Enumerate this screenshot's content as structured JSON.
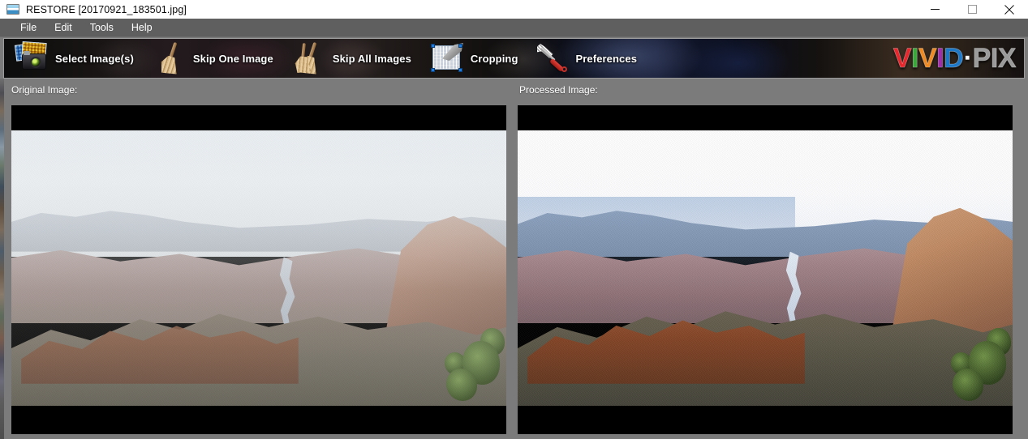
{
  "window": {
    "app_name": "RESTORE",
    "title": "RESTORE  [20170921_183501.jpg]",
    "file_name": "20170921_183501.jpg",
    "icon": "photo-window-icon",
    "controls": {
      "minimize": "minimize-icon",
      "maximize": "maximize-icon",
      "close": "close-icon"
    }
  },
  "menubar": {
    "items": [
      {
        "label": "File"
      },
      {
        "label": "Edit"
      },
      {
        "label": "Tools"
      },
      {
        "label": "Help"
      }
    ]
  },
  "toolbar": {
    "buttons": [
      {
        "label": "Select Image(s)",
        "icon": "camera-photos-icon"
      },
      {
        "label": "Skip One Image",
        "icon": "broom-icon"
      },
      {
        "label": "Skip All Images",
        "icon": "double-broom-icon"
      },
      {
        "label": "Cropping",
        "icon": "crop-grid-icon"
      },
      {
        "label": "Preferences",
        "icon": "wrench-screwdriver-icon"
      }
    ],
    "logo": {
      "letters": [
        {
          "char": "V",
          "color": "#e8262c"
        },
        {
          "char": "I",
          "color": "#3aa83a"
        },
        {
          "char": "V",
          "color": "#ef8a22"
        },
        {
          "char": "I",
          "color": "#a22bb0"
        },
        {
          "char": "D",
          "color": "#1d78c8"
        },
        {
          "char": "·",
          "color": "#ffffff"
        },
        {
          "char": "P",
          "color": "#9a9a9a"
        },
        {
          "char": "I",
          "color": "#9a9a9a"
        },
        {
          "char": "X",
          "color": "#9a9a9a"
        }
      ],
      "text": "VIVID-PIX"
    }
  },
  "panels": {
    "original": {
      "label": "Original Image:",
      "image_description": "Hazy wide view of the Grand Canyon with the Colorado River, letterboxed with black bars"
    },
    "processed": {
      "label": "Processed Image:",
      "image_description": "Same Grand Canyon view after restoration: brighter sky, stronger contrast and color saturation"
    }
  },
  "colors": {
    "window_chrome": "#7b7b7b",
    "menubar": "#5f5f5f",
    "titlebar": "#ffffff",
    "toolbar_dark": "#141010",
    "letterbox": "#000000"
  }
}
